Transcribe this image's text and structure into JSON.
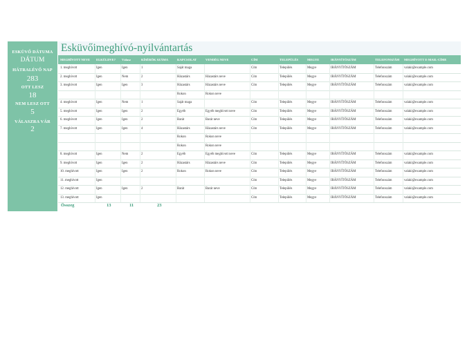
{
  "title": "Esküvőimeghívó-nyilvántartás",
  "sidebar": {
    "items": [
      {
        "label": "ESKÜVŐ DÁTUMA",
        "value": "DÁTUM"
      },
      {
        "label": "HÁTRALÉVŐ NAP",
        "value": "283"
      },
      {
        "label": "OTT LESZ",
        "value": "18"
      },
      {
        "label": "NEM LESZ OTT",
        "value": "5"
      },
      {
        "label": "VÁLASZRA VÁR",
        "value": "2"
      }
    ]
  },
  "table": {
    "headers": [
      "MEGHÍVOTT NEVE",
      "ELKÜLDVE?",
      "Válasz",
      "KÍSÉRŐK SZÁMA",
      "KAPCSOLAT",
      "VENDÉG NEVE",
      "CÍM",
      "TELEPÜLÉS",
      "MEGYE",
      "IRÁNYÍTÓSZÁM",
      "TELEFONSZÁM",
      "MEGHÍVOTT E-MAIL-CÍME"
    ],
    "rows": [
      [
        "1. meghívott",
        "Igen",
        "Igen",
        "1",
        "Saját maga",
        "",
        "Cím",
        "Település",
        "Megye",
        "IRÁNYÍTÓSZÁM",
        "Telefonszám",
        "valaki@example.com"
      ],
      [
        "2. meghívott",
        "Igen",
        "Nem",
        "2",
        "Házastárs",
        "Házastárs neve",
        "Cím",
        "Település",
        "Megye",
        "IRÁNYÍTÓSZÁM",
        "Telefonszám",
        "valaki@example.com"
      ],
      [
        "3. meghívott",
        "Igen",
        "Igen",
        "3",
        "Házastárs",
        "Házastárs neve",
        "Cím",
        "Település",
        "Megye",
        "IRÁNYÍTÓSZÁM",
        "Telefonszám",
        "valaki@example.com"
      ],
      [
        "",
        "",
        "",
        "",
        "Rokon",
        "Rokon neve",
        "",
        "",
        "",
        "",
        "",
        ""
      ],
      [
        "4. meghívott",
        "Igen",
        "Nem",
        "1",
        "Saját maga",
        "",
        "Cím",
        "Település",
        "Megye",
        "IRÁNYÍTÓSZÁM",
        "Telefonszám",
        "valaki@example.com"
      ],
      [
        "5. meghívott",
        "Igen",
        "Igen",
        "2",
        "Egyéb",
        "Egyéb meghívott neve",
        "Cím",
        "Település",
        "Megye",
        "IRÁNYÍTÓSZÁM",
        "Telefonszám",
        "valaki@example.com"
      ],
      [
        "6. meghívott",
        "Igen",
        "Igen",
        "2",
        "Barát",
        "Barát neve",
        "Cím",
        "Település",
        "Megye",
        "IRÁNYÍTÓSZÁM",
        "Telefonszám",
        "valaki@example.com"
      ],
      [
        "7. meghívott",
        "Igen",
        "Igen",
        "4",
        "Házastárs",
        "Házastárs neve",
        "Cím",
        "Település",
        "Megye",
        "IRÁNYÍTÓSZÁM",
        "Telefonszám",
        "valaki@example.com"
      ],
      [
        "",
        "",
        "",
        "",
        "Rokon",
        "Rokon neve",
        "",
        "",
        "",
        "",
        "",
        ""
      ],
      [
        "",
        "",
        "",
        "",
        "Rokon",
        "Rokon neve",
        "",
        "",
        "",
        "",
        "",
        ""
      ],
      [
        "8. meghívott",
        "Igen",
        "Nem",
        "2",
        "Egyéb",
        "Egyéb meghívott neve",
        "Cím",
        "Település",
        "Megye",
        "IRÁNYÍTÓSZÁM",
        "Telefonszám",
        "valaki@example.com"
      ],
      [
        "9. meghívott",
        "Igen",
        "Igen",
        "2",
        "Házastárs",
        "Házastárs neve",
        "Cím",
        "Település",
        "Megye",
        "IRÁNYÍTÓSZÁM",
        "Telefonszám",
        "valaki@example.com"
      ],
      [
        "10. meghívott",
        "Igen",
        "Igen",
        "2",
        "Rokon",
        "Rokon neve",
        "Cím",
        "Település",
        "Megye",
        "IRÁNYÍTÓSZÁM",
        "Telefonszám",
        "valaki@example.com"
      ],
      [
        "11. meghívott",
        "Igen",
        "",
        "",
        "",
        "",
        "Cím",
        "Település",
        "Megye",
        "IRÁNYÍTÓSZÁM",
        "Telefonszám",
        "valaki@example.com"
      ],
      [
        "12. meghívott",
        "Igen",
        "Igen",
        "2",
        "Barát",
        "Barát neve",
        "Cím",
        "Település",
        "Megye",
        "IRÁNYÍTÓSZÁM",
        "Telefonszám",
        "valaki@example.com"
      ],
      [
        "13. meghívott",
        "Igen",
        "",
        "",
        "",
        "",
        "Cím",
        "Település",
        "Megye",
        "IRÁNYÍTÓSZÁM",
        "Telefonszám",
        "valaki@example.com"
      ]
    ]
  },
  "totals": {
    "label": "Összeg",
    "sent": "13",
    "responded": "11",
    "guests": "23"
  },
  "colors": {
    "accent": "#7ec3a7",
    "title": "#3b9c7a"
  }
}
